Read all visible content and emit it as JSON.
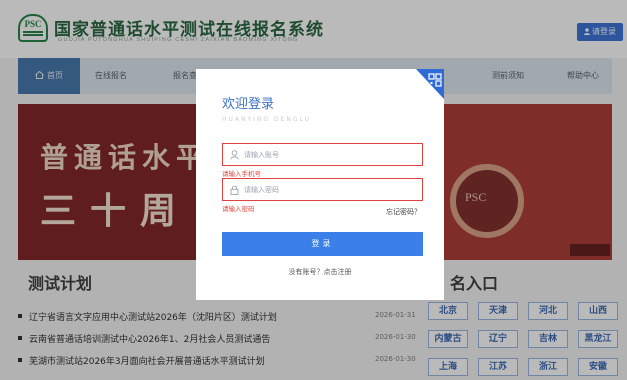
{
  "header": {
    "logo_text": "PSC",
    "site_title": "国家普通话水平测试在线报名系统",
    "site_subtitle": "GUOJIA PUTONGHUA SHUIPING CESHI ZAIXIAN BAOMING XITONG",
    "login_label": "请登录"
  },
  "nav": {
    "items": [
      {
        "label": "首页",
        "icon": "home-icon",
        "active": true
      },
      {
        "label": "在线报名"
      },
      {
        "label": "报名查"
      },
      {
        "label": "测前须知"
      },
      {
        "label": "帮助中心"
      }
    ]
  },
  "banner": {
    "line1": "普通话水平",
    "line2": "三十周",
    "logo": "PSC"
  },
  "plan": {
    "title": "测试计划",
    "items": [
      {
        "text": "辽宁省语言文字应用中心测试站2026年（沈阳片区）测试计划",
        "date": "2026-01-31"
      },
      {
        "text": "云南省普通话培训测试中心2026年1、2月社会人员测试通告",
        "date": "2026-01-30"
      },
      {
        "text": "芜湖市测试站2026年3月面向社会开展普通话水平测试计划",
        "date": "2026-01-30"
      }
    ]
  },
  "entry": {
    "title": "名入口",
    "provinces": [
      "北京",
      "天津",
      "河北",
      "山西",
      "内蒙古",
      "辽宁",
      "吉林",
      "黑龙江",
      "上海",
      "江苏",
      "浙江",
      "安徽"
    ]
  },
  "modal": {
    "title": "欢迎登录",
    "subtitle": "HUANYING DENGLU",
    "account_placeholder": "请输入账号",
    "account_error": "请输入手机号",
    "password_placeholder": "请输入密码",
    "password_error": "请输入密码",
    "forgot_label": "忘记密码？",
    "submit_label": "登录",
    "register_label": "没有账号？点击注册"
  },
  "colors": {
    "primary": "#2f6bd6",
    "button": "#3a80e8",
    "error": "#e0433d",
    "brand_green": "#1b5e34",
    "banner_red": "#8d1c1a"
  }
}
